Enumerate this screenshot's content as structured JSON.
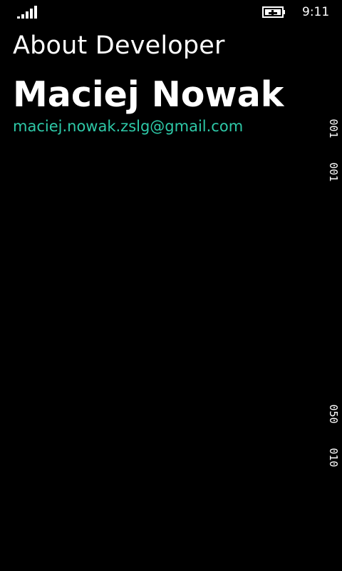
{
  "status_bar": {
    "signal_icon": "signal-strength-icon",
    "battery_icon": "battery-charging-icon",
    "time": "9:11"
  },
  "page": {
    "title": "About Developer"
  },
  "developer": {
    "name": "Maciej Nowak",
    "email": "maciej.nowak.zslg@gmail.com"
  },
  "debug_counters": {
    "frame_rate_ui": "001",
    "frame_rate_render": "001",
    "fill_rate": "050",
    "texture_memory": "010"
  },
  "colors": {
    "background": "#000000",
    "text": "#ffffff",
    "accent": "#2ec9a8"
  }
}
